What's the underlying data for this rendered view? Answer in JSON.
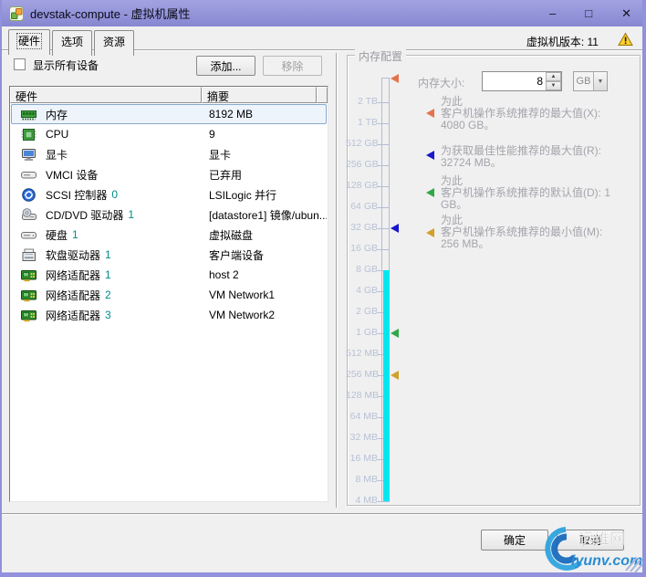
{
  "window": {
    "title": "devstak-compute - 虚拟机属性",
    "controls": {
      "minimize": "–",
      "maximize": "□",
      "close": "✕"
    }
  },
  "tabs": {
    "hardware": "硬件",
    "options": "选项",
    "resources": "资源"
  },
  "version_label": "虚拟机版本: 11",
  "device_panel": {
    "show_all_devices_label": "显示所有设备",
    "add_button": "添加...",
    "remove_button": "移除",
    "columns": {
      "hardware": "硬件",
      "summary": "摘要"
    },
    "rows": [
      {
        "name": "内存",
        "num": "",
        "summary": "8192 MB"
      },
      {
        "name": "CPU",
        "num": "",
        "summary": "9"
      },
      {
        "name": "显卡",
        "num": "",
        "summary": "显卡"
      },
      {
        "name": "VMCI 设备",
        "num": "",
        "summary": "已弃用"
      },
      {
        "name": "SCSI 控制器",
        "num": "0",
        "summary": "LSILogic 并行"
      },
      {
        "name": "CD/DVD 驱动器",
        "num": "1",
        "summary": "[datastore1] 镜像/ubun..."
      },
      {
        "name": "硬盘",
        "num": "1",
        "summary": "虚拟磁盘"
      },
      {
        "name": "软盘驱动器",
        "num": "1",
        "summary": "客户端设备"
      },
      {
        "name": "网络适配器",
        "num": "1",
        "summary": "host 2"
      },
      {
        "name": "网络适配器",
        "num": "2",
        "summary": "VM Network1"
      },
      {
        "name": "网络适配器",
        "num": "3",
        "summary": "VM Network2"
      }
    ]
  },
  "memory_panel": {
    "group_title": "内存配置",
    "size_label": "内存大小:",
    "size_value": "8",
    "unit_value": "GB",
    "scale_ticks": [
      "2 TB",
      "1 TB",
      "512 GB",
      "256 GB",
      "128 GB",
      "64 GB",
      "32 GB",
      "16 GB",
      "8 GB",
      "4 GB",
      "2 GB",
      "1 GB",
      "512 MB",
      "256 MB",
      "128 MB",
      "64 MB",
      "32 MB",
      "16 MB",
      "8 MB",
      "4 MB"
    ],
    "current_value_mb": 8192,
    "notes": [
      {
        "marker": "maximum-recommended",
        "color": "#e4744f",
        "lines": [
          "为此",
          "客户机操作系统推荐的最大值(X):",
          "4080 GB。"
        ]
      },
      {
        "marker": "best-performance",
        "color": "#1717cf",
        "lines": [
          "为获取最佳性能推荐的最大值(R):",
          "32724 MB。"
        ]
      },
      {
        "marker": "default-recommended",
        "color": "#2fa848",
        "lines": [
          "为此",
          "客户机操作系统推荐的默认值(D): 1",
          "GB。"
        ]
      },
      {
        "marker": "minimum-recommended",
        "color": "#d2a02a",
        "lines": [
          "为此",
          "客户机操作系统推荐的最小值(M):",
          "256 MB。"
        ]
      }
    ]
  },
  "icons": {
    "spin_up": "▲",
    "spin_down": "▼",
    "combo_arrow": "▼"
  },
  "footer": {
    "ok_button": "确定",
    "cancel_button": "取消"
  },
  "watermark": {
    "site": "iyunv.com",
    "name": "运维网"
  },
  "colors": {
    "titlebar": "#9191dc",
    "selection_bg": "#edf4fc",
    "selection_border": "#8aa8cc",
    "memory_bar_cyan": "#00e7f2",
    "device_number_teal": "#008b8b",
    "marker_max_orange": "#e4744f",
    "marker_best_blue": "#1717cf",
    "marker_default_green": "#2fa848",
    "marker_min_amber": "#d2a02a"
  }
}
